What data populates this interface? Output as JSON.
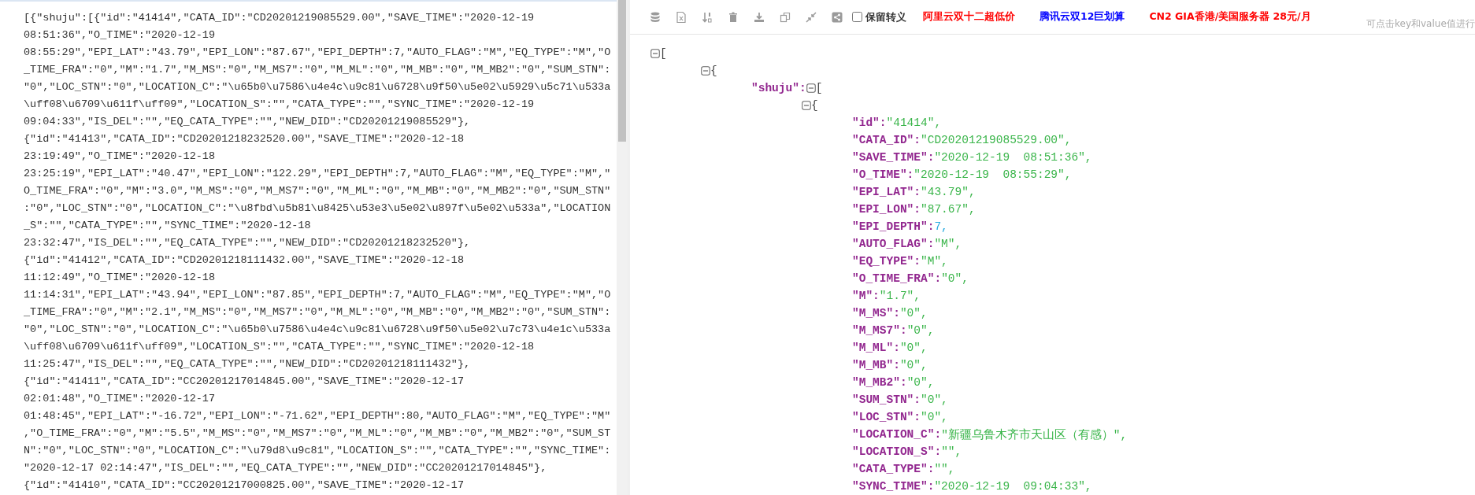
{
  "source_text": {
    "lines": [
      "[{\"shuju\":[{\"id\":\"41414\",\"CATA_ID\":\"CD20201219085529.00\",\"SAVE_TIME\":\"2020-12-19",
      "08:51:36\",\"O_TIME\":\"2020-12-19",
      "08:55:29\",\"EPI_LAT\":\"43.79\",\"EPI_LON\":\"87.67\",\"EPI_DEPTH\":7,\"AUTO_FLAG\":\"M\",\"EQ_TYPE\":\"M\",\"O",
      "_TIME_FRA\":\"0\",\"M\":\"1.7\",\"M_MS\":\"0\",\"M_MS7\":\"0\",\"M_ML\":\"0\",\"M_MB\":\"0\",\"M_MB2\":\"0\",\"SUM_STN\":",
      "\"0\",\"LOC_STN\":\"0\",\"LOCATION_C\":\"\\u65b0\\u7586\\u4e4c\\u9c81\\u6728\\u9f50\\u5e02\\u5929\\u5c71\\u533a",
      "\\uff08\\u6709\\u611f\\uff09\",\"LOCATION_S\":\"\",\"CATA_TYPE\":\"\",\"SYNC_TIME\":\"2020-12-19",
      "09:04:33\",\"IS_DEL\":\"\",\"EQ_CATA_TYPE\":\"\",\"NEW_DID\":\"CD20201219085529\"},",
      "{\"id\":\"41413\",\"CATA_ID\":\"CD20201218232520.00\",\"SAVE_TIME\":\"2020-12-18",
      "23:19:49\",\"O_TIME\":\"2020-12-18",
      "23:25:19\",\"EPI_LAT\":\"40.47\",\"EPI_LON\":\"122.29\",\"EPI_DEPTH\":7,\"AUTO_FLAG\":\"M\",\"EQ_TYPE\":\"M\",\"",
      "O_TIME_FRA\":\"0\",\"M\":\"3.0\",\"M_MS\":\"0\",\"M_MS7\":\"0\",\"M_ML\":\"0\",\"M_MB\":\"0\",\"M_MB2\":\"0\",\"SUM_STN\"",
      ":\"0\",\"LOC_STN\":\"0\",\"LOCATION_C\":\"\\u8fbd\\u5b81\\u8425\\u53e3\\u5e02\\u897f\\u5e02\\u533a\",\"LOCATION",
      "_S\":\"\",\"CATA_TYPE\":\"\",\"SYNC_TIME\":\"2020-12-18",
      "23:32:47\",\"IS_DEL\":\"\",\"EQ_CATA_TYPE\":\"\",\"NEW_DID\":\"CD20201218232520\"},",
      "{\"id\":\"41412\",\"CATA_ID\":\"CD20201218111432.00\",\"SAVE_TIME\":\"2020-12-18",
      "11:12:49\",\"O_TIME\":\"2020-12-18",
      "11:14:31\",\"EPI_LAT\":\"43.94\",\"EPI_LON\":\"87.85\",\"EPI_DEPTH\":7,\"AUTO_FLAG\":\"M\",\"EQ_TYPE\":\"M\",\"O",
      "_TIME_FRA\":\"0\",\"M\":\"2.1\",\"M_MS\":\"0\",\"M_MS7\":\"0\",\"M_ML\":\"0\",\"M_MB\":\"0\",\"M_MB2\":\"0\",\"SUM_STN\":",
      "\"0\",\"LOC_STN\":\"0\",\"LOCATION_C\":\"\\u65b0\\u7586\\u4e4c\\u9c81\\u6728\\u9f50\\u5e02\\u7c73\\u4e1c\\u533a",
      "\\uff08\\u6709\\u611f\\uff09\",\"LOCATION_S\":\"\",\"CATA_TYPE\":\"\",\"SYNC_TIME\":\"2020-12-18",
      "11:25:47\",\"IS_DEL\":\"\",\"EQ_CATA_TYPE\":\"\",\"NEW_DID\":\"CD20201218111432\"},",
      "{\"id\":\"41411\",\"CATA_ID\":\"CC20201217014845.00\",\"SAVE_TIME\":\"2020-12-17",
      "02:01:48\",\"O_TIME\":\"2020-12-17",
      "01:48:45\",\"EPI_LAT\":\"-16.72\",\"EPI_LON\":\"-71.62\",\"EPI_DEPTH\":80,\"AUTO_FLAG\":\"M\",\"EQ_TYPE\":\"M\"",
      ",\"O_TIME_FRA\":\"0\",\"M\":\"5.5\",\"M_MS\":\"0\",\"M_MS7\":\"0\",\"M_ML\":\"0\",\"M_MB\":\"0\",\"M_MB2\":\"0\",\"SUM_ST",
      "N\":\"0\",\"LOC_STN\":\"0\",\"LOCATION_C\":\"\\u79d8\\u9c81\",\"LOCATION_S\":\"\",\"CATA_TYPE\":\"\",\"SYNC_TIME\":",
      "\"2020-12-17 02:14:47\",\"IS_DEL\":\"\",\"EQ_CATA_TYPE\":\"\",\"NEW_DID\":\"CC20201217014845\"},",
      "{\"id\":\"41410\",\"CATA_ID\":\"CC20201217000825.00\",\"SAVE_TIME\":\"2020-12-17"
    ]
  },
  "toolbar": {
    "keep_escape": {
      "label": "保留转义",
      "checked": false
    },
    "links": [
      {
        "label": "阿里云双十二超低价",
        "color": "#ff0000"
      },
      {
        "label": "腾讯云双12巨划算",
        "color": "#0000ff"
      },
      {
        "label": "CN2 GIA香港/美国服务器 28元/月",
        "color": "#ff0000"
      }
    ]
  },
  "hint": "可点击key和value值进行",
  "tree": {
    "kind": "array",
    "open": "[",
    "expanded": true,
    "children": [
      {
        "kind": "object",
        "open": "{",
        "expanded": true,
        "children": [
          {
            "kind": "array",
            "key": "\"shuju\":",
            "open": "[",
            "expanded": true,
            "children": [
              {
                "kind": "object",
                "open": "{",
                "expanded": true,
                "children": [
                  {
                    "kind": "string",
                    "key": "\"id\":",
                    "value": "\"41414\","
                  },
                  {
                    "kind": "string",
                    "key": "\"CATA_ID\":",
                    "value": "\"CD20201219085529.00\","
                  },
                  {
                    "kind": "string",
                    "key": "\"SAVE_TIME\":",
                    "value": "\"2020-12-19  08:51:36\","
                  },
                  {
                    "kind": "string",
                    "key": "\"O_TIME\":",
                    "value": "\"2020-12-19  08:55:29\","
                  },
                  {
                    "kind": "string",
                    "key": "\"EPI_LAT\":",
                    "value": "\"43.79\","
                  },
                  {
                    "kind": "string",
                    "key": "\"EPI_LON\":",
                    "value": "\"87.67\","
                  },
                  {
                    "kind": "number",
                    "key": "\"EPI_DEPTH\":",
                    "value": "7,"
                  },
                  {
                    "kind": "string",
                    "key": "\"AUTO_FLAG\":",
                    "value": "\"M\","
                  },
                  {
                    "kind": "string",
                    "key": "\"EQ_TYPE\":",
                    "value": "\"M\","
                  },
                  {
                    "kind": "string",
                    "key": "\"O_TIME_FRA\":",
                    "value": "\"0\","
                  },
                  {
                    "kind": "string",
                    "key": "\"M\":",
                    "value": "\"1.7\","
                  },
                  {
                    "kind": "string",
                    "key": "\"M_MS\":",
                    "value": "\"0\","
                  },
                  {
                    "kind": "string",
                    "key": "\"M_MS7\":",
                    "value": "\"0\","
                  },
                  {
                    "kind": "string",
                    "key": "\"M_ML\":",
                    "value": "\"0\","
                  },
                  {
                    "kind": "string",
                    "key": "\"M_MB\":",
                    "value": "\"0\","
                  },
                  {
                    "kind": "string",
                    "key": "\"M_MB2\":",
                    "value": "\"0\","
                  },
                  {
                    "kind": "string",
                    "key": "\"SUM_STN\":",
                    "value": "\"0\","
                  },
                  {
                    "kind": "string",
                    "key": "\"LOC_STN\":",
                    "value": "\"0\","
                  },
                  {
                    "kind": "string",
                    "key": "\"LOCATION_C\":",
                    "value": "\"新疆乌鲁木齐市天山区（有感）\","
                  },
                  {
                    "kind": "string",
                    "key": "\"LOCATION_S\":",
                    "value": "\"\","
                  },
                  {
                    "kind": "string",
                    "key": "\"CATA_TYPE\":",
                    "value": "\"\","
                  },
                  {
                    "kind": "string",
                    "key": "\"SYNC_TIME\":",
                    "value": "\"2020-12-19  09:04:33\","
                  }
                ]
              }
            ]
          }
        ]
      }
    ]
  }
}
